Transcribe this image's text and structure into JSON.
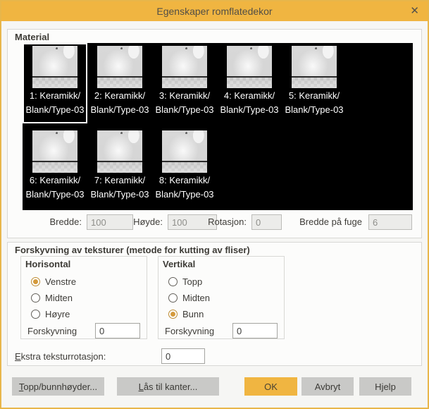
{
  "window": {
    "title": "Egenskaper romflatedekor",
    "close_icon": "✕"
  },
  "material": {
    "group_label": "Material",
    "tiles": [
      {
        "index": 1,
        "label_line1": "1: Keramikk/",
        "label_line2": "Blank/Type-03",
        "selected": true
      },
      {
        "index": 2,
        "label_line1": "2: Keramikk/",
        "label_line2": "Blank/Type-03",
        "selected": false
      },
      {
        "index": 3,
        "label_line1": "3: Keramikk/",
        "label_line2": "Blank/Type-03",
        "selected": false
      },
      {
        "index": 4,
        "label_line1": "4: Keramikk/",
        "label_line2": "Blank/Type-03",
        "selected": false
      },
      {
        "index": 5,
        "label_line1": "5: Keramikk/",
        "label_line2": "Blank/Type-03",
        "selected": false
      },
      {
        "index": 6,
        "label_line1": "6: Keramikk/",
        "label_line2": "Blank/Type-03",
        "selected": false
      },
      {
        "index": 7,
        "label_line1": "7: Keramikk/",
        "label_line2": "Blank/Type-03",
        "selected": false
      },
      {
        "index": 8,
        "label_line1": "8: Keramikk/",
        "label_line2": "Blank/Type-03",
        "selected": false
      }
    ],
    "fields": [
      {
        "label": "Bredde:",
        "value": "100",
        "disabled": true
      },
      {
        "label": "Høyde:",
        "value": "100",
        "disabled": true
      },
      {
        "label": "Rotasjon:",
        "value": "0",
        "disabled": true
      },
      {
        "label": "Bredde på fuge",
        "value": "6",
        "disabled": true
      }
    ]
  },
  "offset": {
    "group_label": "Forskyvning av teksturer (metode for kutting av fliser)",
    "horizontal": {
      "group_label": "Horisontal",
      "options": [
        {
          "label": "Venstre",
          "selected": true
        },
        {
          "label": "Midten",
          "selected": false
        },
        {
          "label": "Høyre",
          "selected": false
        }
      ],
      "offset_label": "Forskyvning",
      "offset_value": "0"
    },
    "vertical": {
      "group_label": "Vertikal",
      "options": [
        {
          "label": "Topp",
          "selected": false
        },
        {
          "label": "Midten",
          "selected": false
        },
        {
          "label": "Bunn",
          "selected": true
        }
      ],
      "offset_label": "Forskyvning",
      "offset_value": "0"
    },
    "extra_rotation": {
      "label": "Ekstra teksturrotasjon:",
      "mnemonic_index": 0,
      "value": "0"
    }
  },
  "buttons": {
    "top_bottom_heights": {
      "label": "Topp/bunnhøyder...",
      "mnemonic_index": 0
    },
    "lock_to_edges": {
      "label": "Lås til kanter...",
      "mnemonic_index": 0
    },
    "ok": {
      "label": "OK"
    },
    "cancel": {
      "label": "Avbryt"
    },
    "help": {
      "label": "Hjelp",
      "mnemonic_index": 1
    }
  },
  "colors": {
    "accent": "#f0b541",
    "titlebar_bg": "#f0b541",
    "dialog_border": "#e8b64a",
    "tile_panel_bg": "#000000",
    "selected_tile_border": "#ffffff",
    "button_bg": "#c9c9c7",
    "radio_selected": "#d49a3c"
  }
}
